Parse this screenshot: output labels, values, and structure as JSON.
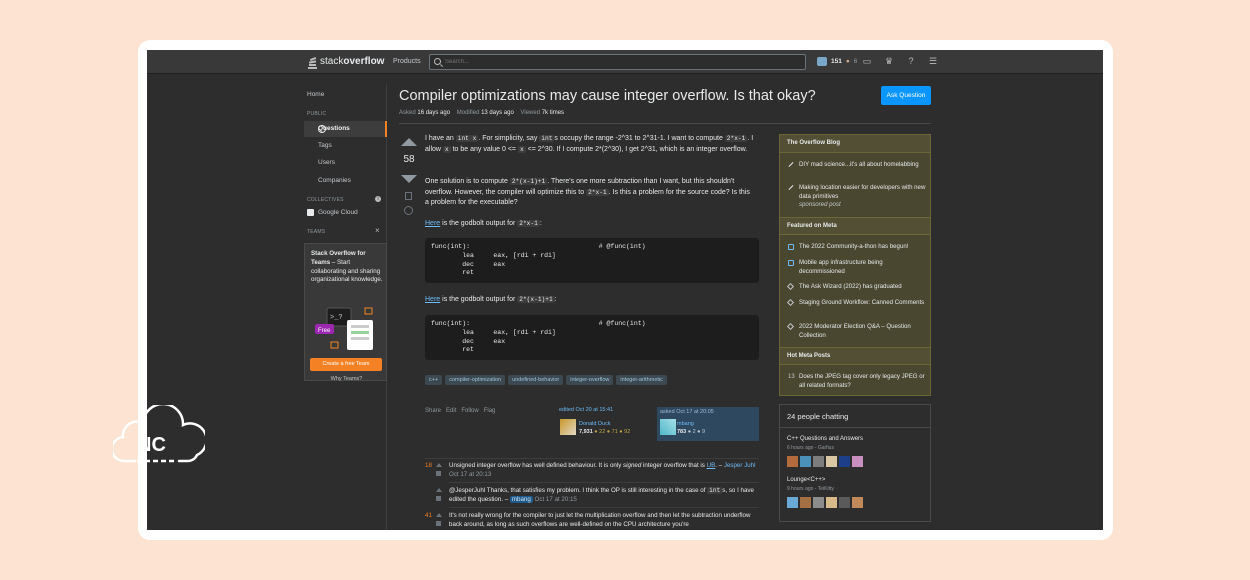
{
  "topbar": {
    "logo_light": "stack",
    "logo_bold": "overflow",
    "products": "Products",
    "search_placeholder": "Search...",
    "reputation": "151",
    "bronze_badges": "6"
  },
  "sidebar": {
    "home": "Home",
    "public_heading": "PUBLIC",
    "questions": "Questions",
    "tags": "Tags",
    "users": "Users",
    "companies": "Companies",
    "collectives_heading": "COLLECTIVES",
    "google_cloud": "Google Cloud",
    "teams_heading": "TEAMS",
    "teams_title": "Stack Overflow for Teams",
    "teams_text": " – Start collaborating and sharing organizational knowledge.",
    "free_label": "Free",
    "teams_button": "Create a free Team",
    "why_teams": "Why Teams?"
  },
  "question": {
    "title": "Compiler optimizations may cause integer overflow. Is that okay?",
    "ask_button": "Ask Question",
    "asked_label": "Asked",
    "asked_value": "16 days ago",
    "modified_label": "Modified",
    "modified_value": "13 days ago",
    "viewed_label": "Viewed",
    "viewed_value": "7k times",
    "votes": "58",
    "p1_a": "I have an ",
    "p1_code1": "int x",
    "p1_b": ". For simplicity, say ",
    "p1_code2": "int",
    "p1_c": "s occupy the range -2^31 to 2^31-1. I want to compute ",
    "p1_code3": "2*x-1",
    "p1_d": ". I allow ",
    "p1_code4": "x",
    "p1_e": " to be any value 0 <= ",
    "p1_code5": "x",
    "p1_f": " <= 2^30. If I compute 2*(2^30), I get 2^31, which is an integer overflow.",
    "p2_a": "One solution is to compute ",
    "p2_code1": "2*(x-1)+1",
    "p2_b": ". There's one more subtraction than I want, but this shouldn't overflow. However, the compiler will optimize this to ",
    "p2_code2": "2*x-1",
    "p2_c": ". Is this a problem for the source code? Is this a problem for the executable?",
    "p3_link": "Here",
    "p3_text": " is the godbolt output for ",
    "p3_code": "2*x-1",
    "p3_end": ":",
    "code1": [
      "func(int):                                 # @func(int)",
      "        lea     eax, [rdi + rdi]",
      "        dec     eax",
      "        ret"
    ],
    "p4_link": "Here",
    "p4_text": " is the godbolt output for ",
    "p4_code": "2*(x-1)+1",
    "p4_end": ":",
    "code2": [
      "func(int):                                 # @func(int)",
      "        lea     eax, [rdi + rdi]",
      "        dec     eax",
      "        ret"
    ],
    "tags": [
      "c++",
      "compiler-optimization",
      "undefined-behavior",
      "integer-overflow",
      "integer-arithmetic"
    ],
    "menu": [
      "Share",
      "Edit",
      "Follow",
      "Flag"
    ],
    "edited_label": "edited Oct 20 at 15:41",
    "editor_name": "Donald Duck",
    "editor_rep": "7,931",
    "editor_badges": "● 22  ● 71  ● 92",
    "asked_card_label": "asked Oct 17 at 20:05",
    "asker_name": "mbang",
    "asker_rep": "783",
    "asker_badges": "● 2  ● 9"
  },
  "comments": [
    {
      "score": "18",
      "text_a": "Unsigned integer overflow has well defined behaviour. It is only ",
      "text_em": "signed",
      "text_b": " integer overflow that is ",
      "link": "UB",
      "text_c": ". – ",
      "user": "Jesper Juhl",
      "date": "Oct 17 at 20:13"
    },
    {
      "score": "",
      "text_a": "@JesperJuhl Thanks, that satisfies my problem. I think the OP is still interesting in the case of ",
      "code": "int",
      "text_b": "s, so I have edited the question. – ",
      "user": "mbang",
      "date": "Oct 17 at 20:15"
    },
    {
      "score": "41",
      "text_a": "It's not really wrong for the compiler to just let the multiplication overflow and then let the subtraction underflow back around, as long as such overflows are well-defined on the CPU architecture you're"
    }
  ],
  "blog": {
    "heading": "The Overflow Blog",
    "items": [
      "DIY mad science...it's all about homelabbing",
      "Making location easier for developers with new data primitives"
    ],
    "sponsored": "sponsored post",
    "meta_heading": "Featured on Meta",
    "meta_items": [
      "The 2022 Community-a-thon has begun!",
      "Mobile app infrastructure being decommissioned",
      "The Ask Wizard (2022) has graduated",
      "Staging Ground Workflow: Canned Comments",
      "2022 Moderator Election Q&A – Question Collection"
    ],
    "hot_heading": "Hot Meta Posts",
    "hot_score": "13",
    "hot_item": "Does the JPEG tag cover only legacy JPEG or all related formats?"
  },
  "chat": {
    "title": "24 people chatting",
    "room1": "C++ Questions and Answers",
    "room1_meta": "6 hours ago - Garfius",
    "room2": "Lounge<C++>",
    "room2_meta": "9 hours ago - TeiKitty"
  },
  "watermark": {
    "text": "NC"
  }
}
